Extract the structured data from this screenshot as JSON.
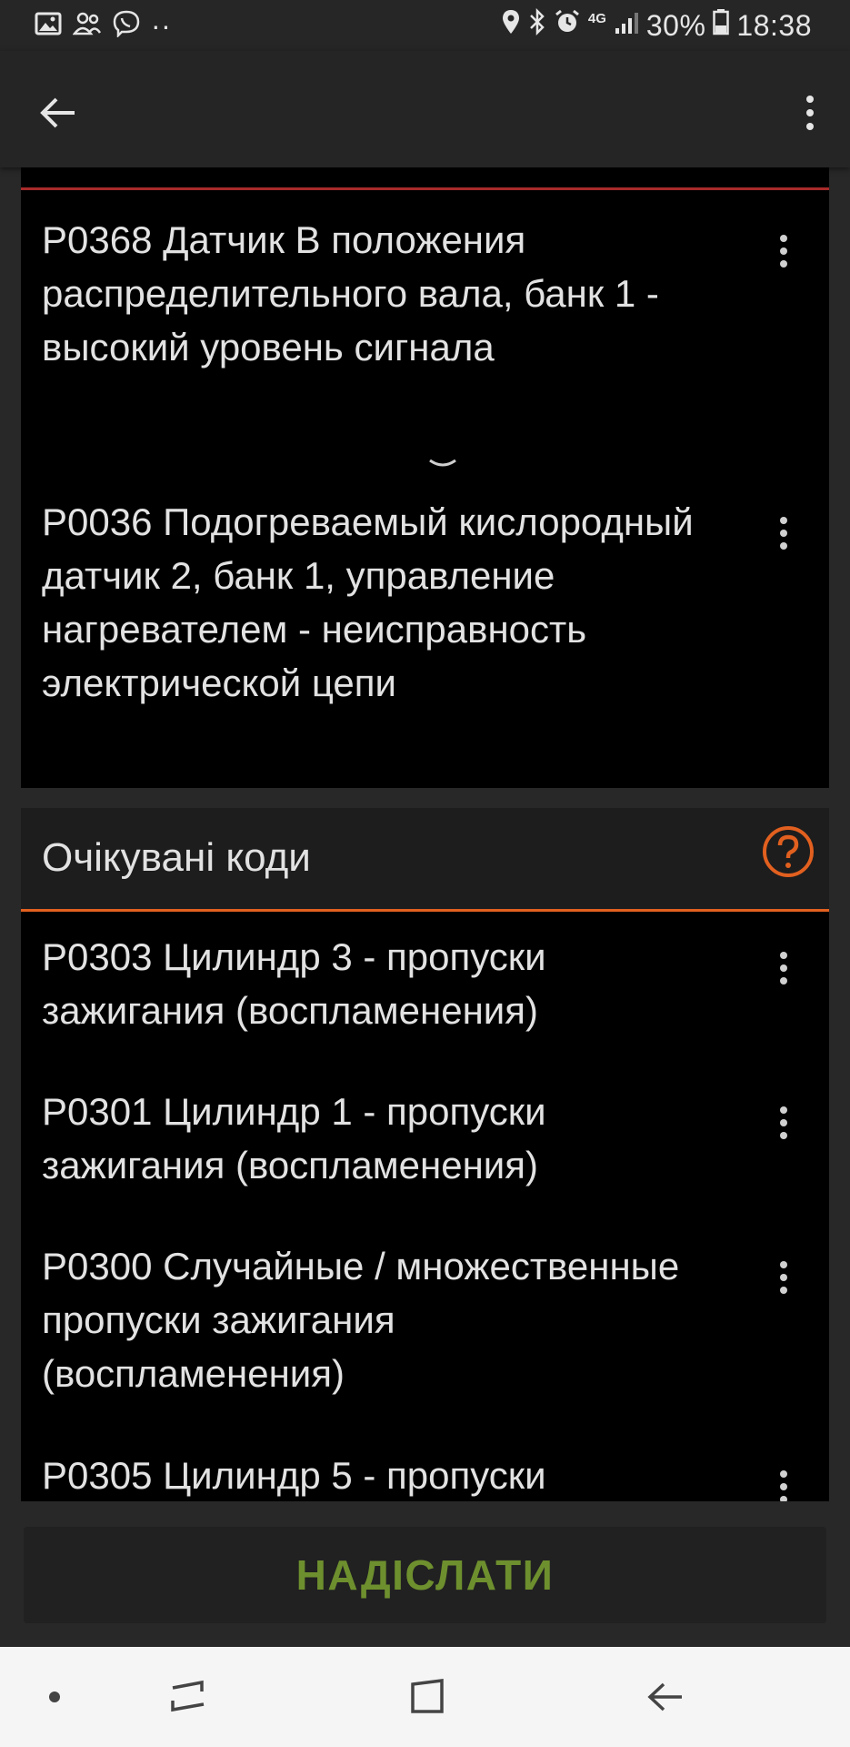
{
  "status_bar": {
    "battery_percent": "30%",
    "time": "18:38",
    "network_type": "4G",
    "overflow_dots": "··"
  },
  "toolbar": {
    "back_icon": "arrow-left-icon",
    "menu_icon": "more-vert-icon"
  },
  "stored_codes": [
    {
      "text": "P0368 Датчик B положения распределительного вала, банк 1 - высокий уровень сигнала"
    },
    {
      "text": "P0036 Подогреваемый кислородный датчик 2, банк 1, управление нагревателем - неисправность электрической цепи"
    }
  ],
  "pending_section": {
    "title": "Очікувані коди",
    "help_icon": "help-circle-icon"
  },
  "pending_codes": [
    {
      "text": "P0303 Цилиндр 3 - пропуски зажигания (воспламенения)"
    },
    {
      "text": "P0301 Цилиндр 1 - пропуски зажигания (воспламенения)"
    },
    {
      "text": "P0300 Случайные / множественные пропуски зажигания (воспламенения)"
    },
    {
      "text": "P0305 Цилиндр 5 - пропуски"
    }
  ],
  "send_button": {
    "label": "НАДІСЛАТИ"
  },
  "colors": {
    "accent_orange": "#e2601f",
    "accent_red": "#a82a2a",
    "send_green": "#6e8f2e"
  }
}
